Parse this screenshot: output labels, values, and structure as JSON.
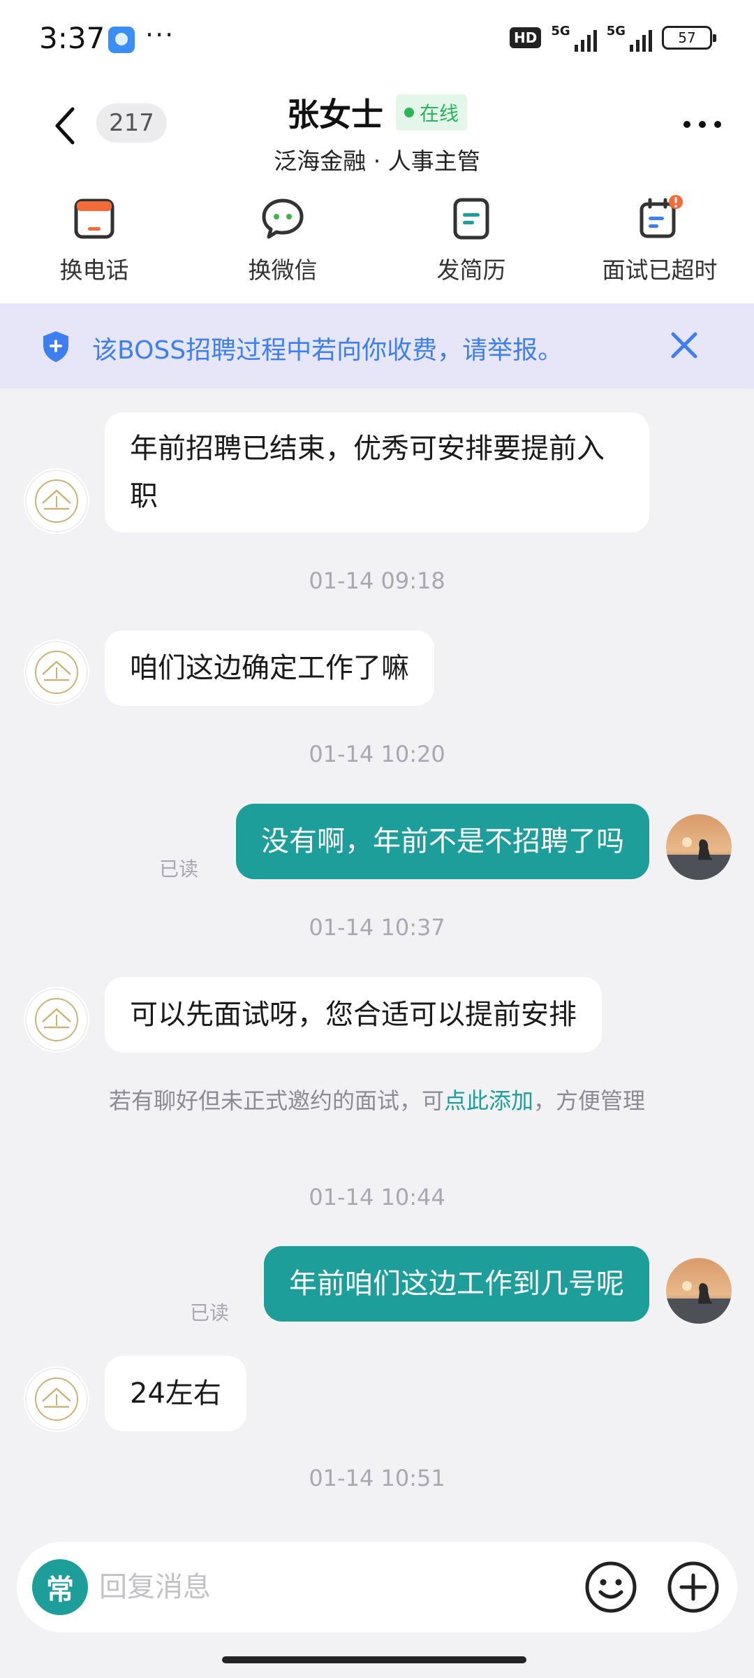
{
  "status_bar": {
    "time": "3:37",
    "dots": "···",
    "hd_label": "HD",
    "network_1": "5G",
    "network_2": "5G",
    "battery": "57"
  },
  "header": {
    "unread_count": "217",
    "contact_name": "张女士",
    "online_label": "在线",
    "subtitle": "泛海金融 · 人事主管"
  },
  "toolbar": {
    "items": [
      {
        "label": "换电话",
        "icon": "phone-card-icon"
      },
      {
        "label": "换微信",
        "icon": "wechat-bubble-icon"
      },
      {
        "label": "发简历",
        "icon": "resume-icon"
      },
      {
        "label": "面试已超时",
        "icon": "calendar-alert-icon"
      }
    ]
  },
  "notice": {
    "text": "该BOSS招聘过程中若向你收费，请举报。"
  },
  "messages": [
    {
      "side": "in",
      "text": "年前招聘已结束，优秀可安排要提前入职"
    },
    {
      "time": "01-14 09:18"
    },
    {
      "side": "in",
      "text": "咱们这边确定工作了嘛"
    },
    {
      "time": "01-14 10:20"
    },
    {
      "side": "out",
      "text": "没有啊，年前不是不招聘了吗",
      "status": "已读"
    },
    {
      "time": "01-14 10:37"
    },
    {
      "side": "in",
      "text": "可以先面试呀，您合适可以提前安排"
    },
    {
      "system": "若有聊好但未正式邀约的面试，可",
      "link": "点此添加",
      "after": "，方便管理"
    },
    {
      "time": "01-14 10:44"
    },
    {
      "side": "out",
      "text": "年前咱们这边工作到几号呢",
      "status": "已读"
    },
    {
      "side": "in",
      "text": "24左右"
    },
    {
      "time": "01-14 10:51"
    }
  ],
  "input": {
    "quick_label": "常",
    "placeholder": "回复消息"
  },
  "colors": {
    "accent": "#1e9e9a",
    "banner_bg": "#e7e6f8",
    "banner_text": "#3d7ff0",
    "online": "#2bb55a",
    "alert": "#f26b3a"
  }
}
